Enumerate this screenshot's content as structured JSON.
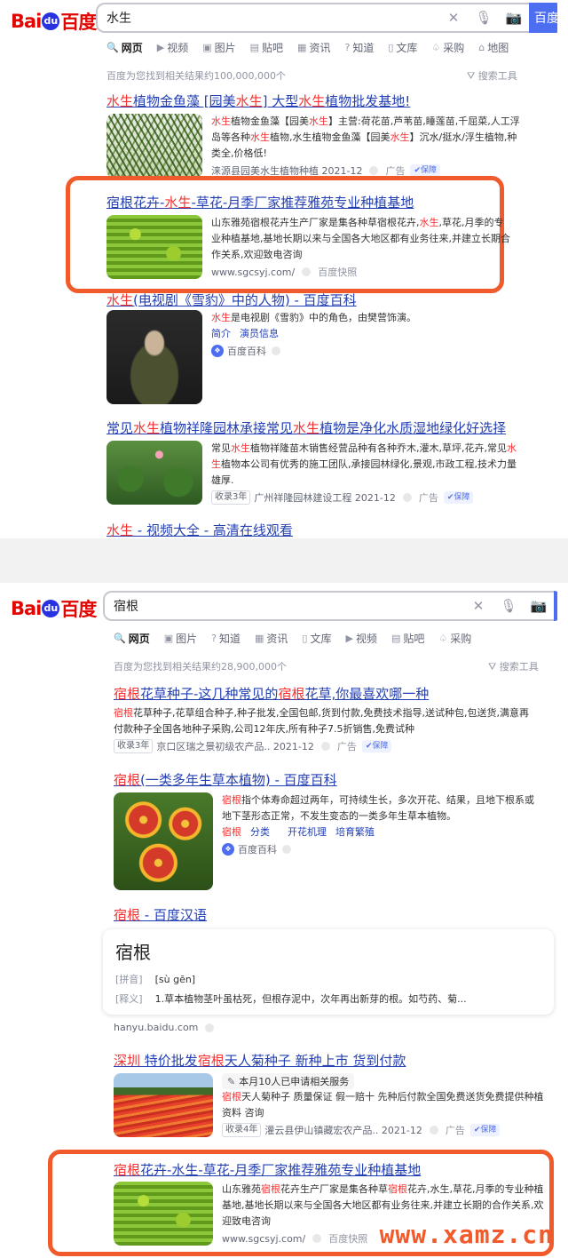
{
  "panel1": {
    "logo": {
      "bai": "Bai",
      "paw": "du",
      "du": "百度"
    },
    "query": "水生",
    "search_button": "百度",
    "tabs": [
      {
        "icon": "🔍",
        "label": "网页",
        "active": true
      },
      {
        "icon": "▶",
        "label": "视频"
      },
      {
        "icon": "▣",
        "label": "图片"
      },
      {
        "icon": "▤",
        "label": "贴吧"
      },
      {
        "icon": "▦",
        "label": "资讯"
      },
      {
        "icon": "?",
        "label": "知道"
      },
      {
        "icon": "▯",
        "label": "文库"
      },
      {
        "icon": "♤",
        "label": "采购"
      },
      {
        "icon": "⌂",
        "label": "地图"
      }
    ],
    "count": "百度为您找到相关结果约100,000,000个",
    "tools": "搜索工具",
    "results": [
      {
        "title": [
          {
            "t": "水生",
            "hl": true
          },
          {
            "t": "植物金鱼藻 [园美"
          },
          {
            "t": "水生",
            "hl": true
          },
          {
            "t": "] 大型"
          },
          {
            "t": "水生",
            "hl": true
          },
          {
            "t": "植物批发基地!"
          }
        ],
        "text": [
          {
            "t": "水生",
            "hl": true
          },
          {
            "t": "植物金鱼藻【园美"
          },
          {
            "t": "水生",
            "hl": true
          },
          {
            "t": "】主营:荷花苗,芦苇苗,睡莲苗,千屈菜,人工浮岛等各种"
          },
          {
            "t": "水生",
            "hl": true
          },
          {
            "t": "植物,水生植物金鱼藻【园美"
          },
          {
            "t": "水生",
            "hl": true
          },
          {
            "t": "】沉水/挺水/浮生植物,种类全,价格低!"
          }
        ],
        "source": "涞源县园美水生植物种植 2021-12",
        "ad": "广告",
        "badge": "保障"
      },
      {
        "title": [
          {
            "t": "宿根花卉-"
          },
          {
            "t": "水生",
            "hl": true
          },
          {
            "t": "-草花-月季厂家推荐雅苑专业种植基地"
          }
        ],
        "text": [
          {
            "t": "山东雅苑宿根花卉生产厂家是集各种草宿根花卉,"
          },
          {
            "t": "水生",
            "hl": true
          },
          {
            "t": ",草花,月季的专业种植基地,基地长期以来与全国各大地区都有业务往来,并建立长期合作关系,欢迎致电咨询"
          }
        ],
        "source": "www.sgcsyj.com/",
        "snap": "百度快照"
      },
      {
        "title": [
          {
            "t": "水生",
            "hl": true
          },
          {
            "t": "(电视剧《雪豹》中的人物) - 百度百科"
          }
        ],
        "text": [
          {
            "t": "水生",
            "hl": true
          },
          {
            "t": "是电视剧《雪豹》中的角色，由樊营饰演。"
          }
        ],
        "links": [
          "简介",
          "演员信息"
        ],
        "baike": "百度百科"
      },
      {
        "title": [
          {
            "t": "常见"
          },
          {
            "t": "水生",
            "hl": true
          },
          {
            "t": "植物祥隆园林承接常见"
          },
          {
            "t": "水生",
            "hl": true
          },
          {
            "t": "植物是净化水质湿地绿化好选择"
          }
        ],
        "text": [
          {
            "t": "常见"
          },
          {
            "t": "水生",
            "hl": true
          },
          {
            "t": "植物祥隆苗木销售经营品种有各种乔木,灌木,草坪,花卉,常见"
          },
          {
            "t": "水生",
            "hl": true
          },
          {
            "t": "植物本公司有优秀的施工团队,承接园林绿化,景观,市政工程,技术力量雄厚."
          }
        ],
        "tag": "收录3年",
        "source": "广州祥隆园林建设工程 2021-12",
        "ad": "广告",
        "badge": "保障"
      },
      {
        "title": [
          {
            "t": "水生",
            "hl": true
          },
          {
            "t": " - 视频大全 - 高清在线观看"
          }
        ]
      }
    ]
  },
  "panel2": {
    "logo": {
      "bai": "Bai",
      "paw": "du",
      "du": "百度"
    },
    "query": "宿根",
    "tabs": [
      {
        "icon": "🔍",
        "label": "网页",
        "active": true
      },
      {
        "icon": "▣",
        "label": "图片"
      },
      {
        "icon": "?",
        "label": "知道"
      },
      {
        "icon": "▦",
        "label": "资讯"
      },
      {
        "icon": "▯",
        "label": "文库"
      },
      {
        "icon": "▶",
        "label": "视频"
      },
      {
        "icon": "▤",
        "label": "贴吧"
      },
      {
        "icon": "♤",
        "label": "采购"
      }
    ],
    "count": "百度为您找到相关结果约28,900,000个",
    "tools": "搜索工具",
    "results": [
      {
        "title": [
          {
            "t": "宿根",
            "hl": true
          },
          {
            "t": "花草种子-这几种常见的"
          },
          {
            "t": "宿根",
            "hl": true
          },
          {
            "t": "花草,你最喜欢哪一种"
          }
        ],
        "text": [
          {
            "t": "宿根",
            "hl": true
          },
          {
            "t": "花草种子,花草组合种子,种子批发,全国包邮,货到付款,免费技术指导,送试种包,包送货,满意再付款种子全国各地种子采购,公司12年庆,所有种子7.5折销售,免费试种"
          }
        ],
        "tag": "收录3年",
        "source": "京口区瑞之景初级农产品.. 2021-12",
        "ad": "广告",
        "badge": "保障"
      },
      {
        "title": [
          {
            "t": "宿根",
            "hl": true
          },
          {
            "t": "(一类多年生草本植物) - 百度百科"
          }
        ],
        "text": [
          {
            "t": "宿根",
            "hl": true
          },
          {
            "t": "指个体寿命超过两年，可持续生长，多次开花、结果，且地下根系或地下茎形态正常，不发生变态的一类多年生草本植物。"
          }
        ],
        "links": [
          {
            "t": "宿根",
            "hl": true,
            "rest": "分类"
          },
          {
            "t": "开花机理"
          },
          {
            "t": "培育繁殖"
          }
        ],
        "baike": "百度百科"
      },
      {
        "title": [
          {
            "t": "宿根",
            "hl": true
          },
          {
            "t": " - 百度汉语"
          }
        ],
        "dict_word": "宿根",
        "pinyin_label": "[拼音]",
        "pinyin": "[sù gēn]",
        "def_label": "[释义]",
        "def": "1.草本植物茎叶虽枯死，但根存泥中，次年再出新芽的根。如芍药、菊...",
        "source": "hanyu.baidu.com"
      },
      {
        "title": [
          {
            "t": "深圳",
            "hl": true
          },
          {
            "t": " 特价批发"
          },
          {
            "t": "宿根",
            "hl": true
          },
          {
            "t": "天人菊种子 新种上市 货到付款"
          }
        ],
        "apply": "本月10人已申请相关服务",
        "text": [
          {
            "t": "宿根",
            "hl": true
          },
          {
            "t": "天人菊种子 质量保证 假一赔十 先种后付款全国免费送货免费提供种植资料 咨询"
          }
        ],
        "tag": "收录4年",
        "source": "灌云县伊山镇藏宏农产品.. 2021-12",
        "ad": "广告",
        "badge": "保障"
      },
      {
        "title": [
          {
            "t": "宿根",
            "hl": true
          },
          {
            "t": "花卉-水生-草花-月季厂家推荐雅苑专业种植基地"
          }
        ],
        "text": [
          {
            "t": "山东雅苑"
          },
          {
            "t": "宿根",
            "hl": true
          },
          {
            "t": "花卉生产厂家是集各种草"
          },
          {
            "t": "宿根",
            "hl": true
          },
          {
            "t": "花卉,水生,草花,月季的专业种植基地,基地长期以来与全国各大地区都有业务往来,并建立长期的合作关系,欢迎致电咨询"
          }
        ],
        "source": "www.sgcsyj.com/",
        "snap": "百度快照"
      }
    ]
  },
  "watermark": "www.xamz.cn",
  "colors": {
    "highlight": "#f73131",
    "link": "#2440b3",
    "accent": "#4e6ef2",
    "box": "#f15a2a"
  }
}
